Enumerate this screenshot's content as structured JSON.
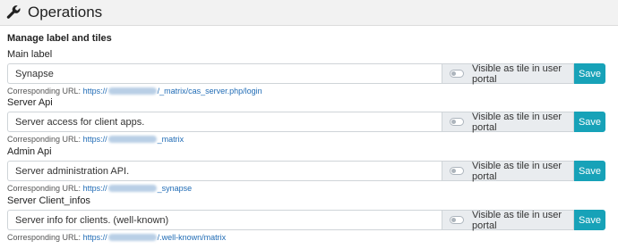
{
  "header": {
    "title": "Operations",
    "icon": "wrench-icon"
  },
  "section_title": "Manage label and tiles",
  "tile_toggle_label": "Visible as tile in user portal",
  "save_label": "Save",
  "url_prefix": "Corresponding URL:",
  "blocks": [
    {
      "label": "Main label",
      "value": "Synapse",
      "url_scheme": "https://",
      "url_path": "/_matrix/cas_server.php/login",
      "visible_as_tile": false
    },
    {
      "label": "Server Api",
      "value": "Server access for client apps.",
      "url_scheme": "https://",
      "url_path": "_matrix",
      "visible_as_tile": false
    },
    {
      "label": "Admin Api",
      "value": "Server administration API.",
      "url_scheme": "https://",
      "url_path": "_synapse",
      "visible_as_tile": false
    },
    {
      "label": "Server Client_infos",
      "value": "Server info for clients. (well-known)",
      "url_scheme": "https://",
      "url_path": "/.well-known/matrix",
      "visible_as_tile": false
    }
  ]
}
